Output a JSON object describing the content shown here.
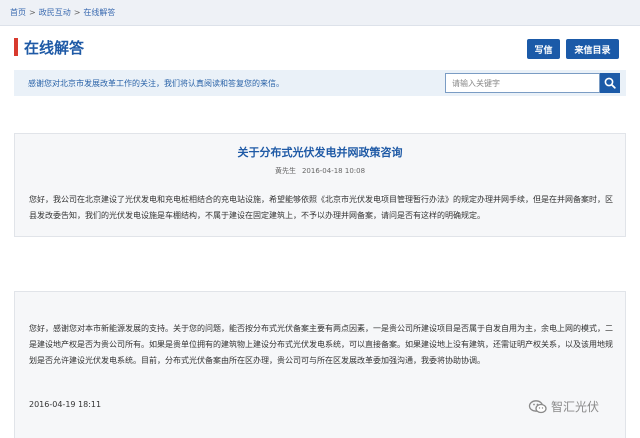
{
  "breadcrumb": {
    "items": [
      "首页",
      "政民互动",
      "在线解答"
    ],
    "separator": ">"
  },
  "header": {
    "title": "在线解答",
    "write_button": "写信",
    "list_button": "来信目录"
  },
  "notice": {
    "text": "感谢您对北京市发展改革工作的关注，我们将认真阅读和答复您的来信。"
  },
  "search": {
    "placeholder": "请输入关键字",
    "icon": "search-icon"
  },
  "question": {
    "title": "关于分布式光伏发电并网政策咨询",
    "author": "黄先生",
    "datetime": "2016-04-18 10:08",
    "body": "您好，我公司在北京建设了光伏发电和充电桩相结合的充电站设施，希望能够依照《北京市光伏发电项目管理暂行办法》的规定办理并网手续，但是在并网备案时，区县发改委告知，我们的光伏发电设施是车棚结构，不属于建设在固定建筑上，不予以办理并网备案，请问是否有这样的明确规定。"
  },
  "answer": {
    "body": "您好，感谢您对本市新能源发展的支持。关于您的问题，能否按分布式光伏备案主要有两点因素，一是贵公司所建设项目是否属于自发自用为主，余电上网的模式，二是建设地产权是否为贵公司所有。如果是贵单位拥有的建筑物上建设分布式光伏发电系统，可以直接备案。如果建设地上没有建筑，还需证明产权关系，以及该用地规划是否允许建设光伏发电系统。目前，分布式光伏备案由所在区办理，贵公司可与所在区发展改革委加强沟通，我委将协助协调。",
    "datetime": "2016-04-19 18:11"
  },
  "watermark": {
    "text": "智汇光伏",
    "icon": "wechat-icon"
  },
  "colors": {
    "accent_blue": "#1b5aa8",
    "title_blue": "#1f5aa6",
    "title_bar_red": "#d83a2e",
    "notice_bg": "#eaf1f8"
  }
}
